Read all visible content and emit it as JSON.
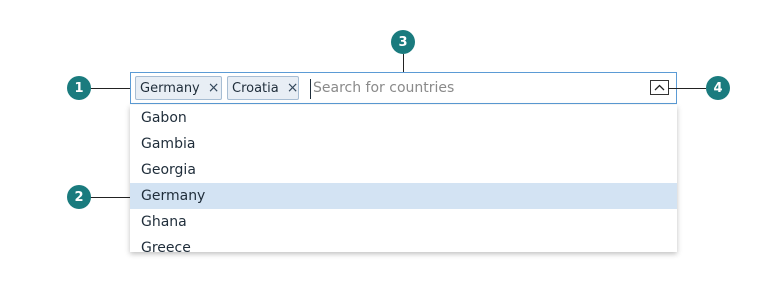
{
  "combobox": {
    "tags": [
      {
        "label": "Germany",
        "remove_glyph": "×"
      },
      {
        "label": "Croatia",
        "remove_glyph": "×"
      }
    ],
    "search": {
      "value": "",
      "placeholder": "Search for countries"
    },
    "toggle_icon": "chevron-up-icon"
  },
  "dropdown": {
    "options": [
      "Gabon",
      "Gambia",
      "Georgia",
      "Germany",
      "Ghana",
      "Greece"
    ],
    "selected": "Germany"
  },
  "callouts": [
    "1",
    "2",
    "3",
    "4"
  ],
  "colors": {
    "accent_border": "#5b9bd5",
    "tag_background": "#e8eef5",
    "selected_background": "#d3e3f3",
    "callout": "#1a7b7e"
  }
}
